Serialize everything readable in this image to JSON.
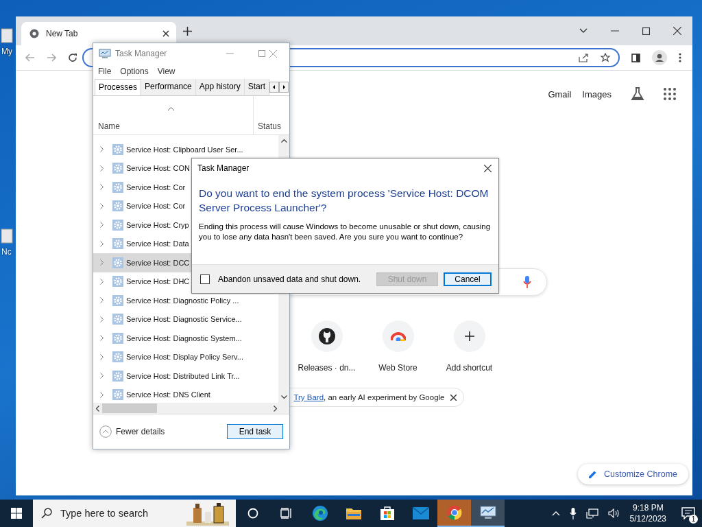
{
  "desktop": {
    "icons": [
      {
        "label": "My"
      },
      {
        "label": "Nc"
      }
    ]
  },
  "browser": {
    "tab": {
      "title": "New Tab"
    },
    "top_links": [
      "Gmail",
      "Images"
    ],
    "shortcuts": [
      {
        "label": "Releases · dn...",
        "kind": "github"
      },
      {
        "label": "Web Store",
        "kind": "webstore"
      },
      {
        "label": "Add shortcut",
        "kind": "add"
      }
    ],
    "bard_banner": {
      "link": "Try Bard",
      "text": ", an early AI experiment by Google"
    },
    "customize_button": "Customize Chrome"
  },
  "task_manager": {
    "title": "Task Manager",
    "menu": [
      "File",
      "Options",
      "View"
    ],
    "tabs": [
      {
        "label": "Processes",
        "selected": true
      },
      {
        "label": "Performance",
        "selected": false
      },
      {
        "label": "App history",
        "selected": false
      },
      {
        "label": "Start",
        "selected": false
      }
    ],
    "columns": [
      "Name",
      "Status"
    ],
    "rows": [
      {
        "name": "Service Host: Clipboard User Ser...",
        "selected": false
      },
      {
        "name": "Service Host: CON",
        "selected": false
      },
      {
        "name": "Service Host: Cor",
        "selected": false
      },
      {
        "name": "Service Host: Cor",
        "selected": false
      },
      {
        "name": "Service Host: Cryp",
        "selected": false
      },
      {
        "name": "Service Host: Data",
        "selected": false
      },
      {
        "name": "Service Host: DCC",
        "selected": true
      },
      {
        "name": "Service Host: DHC",
        "selected": false
      },
      {
        "name": "Service Host: Diagnostic Policy ...",
        "selected": false
      },
      {
        "name": "Service Host: Diagnostic Service...",
        "selected": false
      },
      {
        "name": "Service Host: Diagnostic System...",
        "selected": false
      },
      {
        "name": "Service Host: Display Policy Serv...",
        "selected": false
      },
      {
        "name": "Service Host: Distributed Link Tr...",
        "selected": false
      },
      {
        "name": "Service Host: DNS Client",
        "selected": false
      }
    ],
    "fewer_details": "Fewer details",
    "end_task": "End task"
  },
  "dialog": {
    "title": "Task Manager",
    "heading": "Do you want to end the system process 'Service Host: DCOM Server Process Launcher'?",
    "message": "Ending this process will cause Windows to become unusable or shut down, causing you to lose any data hasn't been saved. Are you sure you want to continue?",
    "checkbox": {
      "label": "Abandon unsaved data and shut down.",
      "checked": false
    },
    "buttons": [
      {
        "label": "Shut down",
        "disabled": true
      },
      {
        "label": "Cancel",
        "disabled": false
      }
    ]
  },
  "taskbar": {
    "search_placeholder": "Type here to search",
    "apps": [
      {
        "kind": "cortana",
        "open": false,
        "flashing": false
      },
      {
        "kind": "taskview",
        "open": false,
        "flashing": false
      },
      {
        "kind": "edge",
        "open": false,
        "flashing": false
      },
      {
        "kind": "explorer",
        "open": false,
        "flashing": false
      },
      {
        "kind": "store",
        "open": false,
        "flashing": false
      },
      {
        "kind": "mail",
        "open": false,
        "flashing": false
      },
      {
        "kind": "chrome",
        "open": true,
        "flashing": true
      },
      {
        "kind": "taskmanager",
        "open": true,
        "flashing": false
      }
    ],
    "time": "9:18 PM",
    "date": "5/12/2023",
    "notification_count": "1"
  }
}
